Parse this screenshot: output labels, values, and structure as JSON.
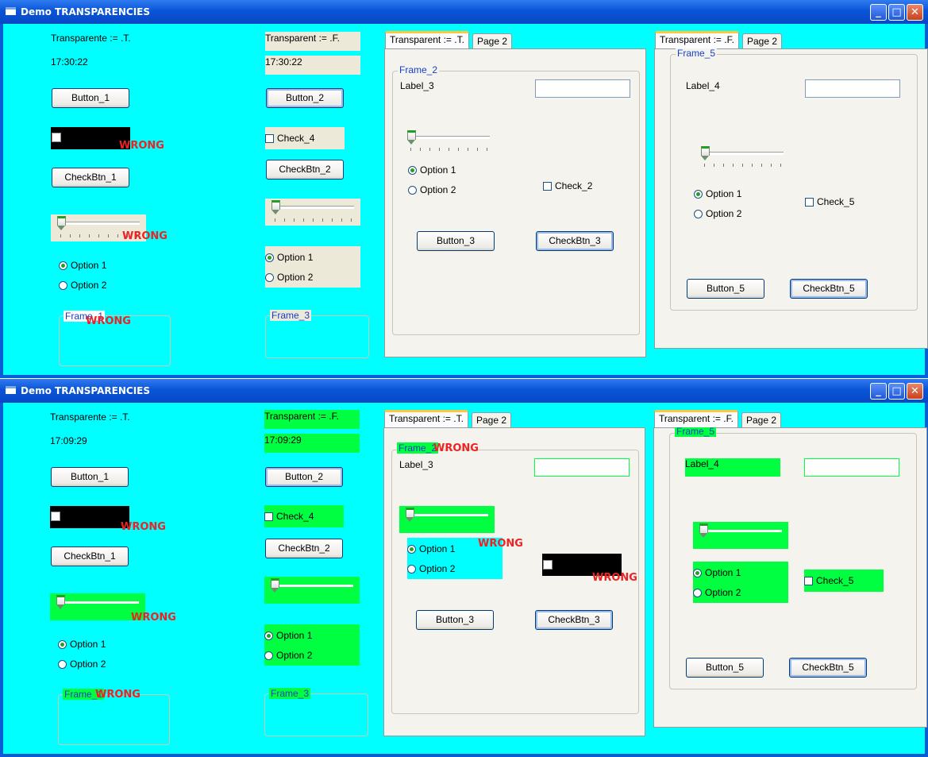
{
  "window_title": "Demo TRANSPARENCIES",
  "title_buttons": {
    "minimize": "_",
    "maximize": "□",
    "close": "✕"
  },
  "colors": {
    "client": "#00ffff",
    "green": "#00ff40",
    "wrong": "#ee2222",
    "titlebar": "#0a55d8"
  },
  "wrong_label": "WRONG",
  "col1": {
    "title": "Transparente := .T.",
    "button": "Button_1",
    "checkbtn": "CheckBtn_1",
    "option1": "Option 1",
    "option2": "Option 2",
    "frame": "Frame_1"
  },
  "col2": {
    "title": "Transparent := .F.",
    "button": "Button_2",
    "check": "Check_4",
    "checkbtn": "CheckBtn_2",
    "option1": "Option 1",
    "option2": "Option 2",
    "frame": "Frame_3"
  },
  "tab1": {
    "tab_label": "Transparent := .T.",
    "page2": "Page 2",
    "frame": "Frame_2",
    "label": "Label_3",
    "option1": "Option 1",
    "option2": "Option 2",
    "check": "Check_2",
    "button": "Button_3",
    "checkbtn": "CheckBtn_3"
  },
  "tab2": {
    "tab_label": "Transparent := .F.",
    "page2": "Page 2",
    "frame": "Frame_5",
    "label": "Label_4",
    "option1": "Option 1",
    "option2": "Option 2",
    "check": "Check_5",
    "button": "Button_5",
    "checkbtn": "CheckBtn_5"
  },
  "window1": {
    "time": "17:30:22"
  },
  "window2": {
    "time": "17:09:29"
  }
}
